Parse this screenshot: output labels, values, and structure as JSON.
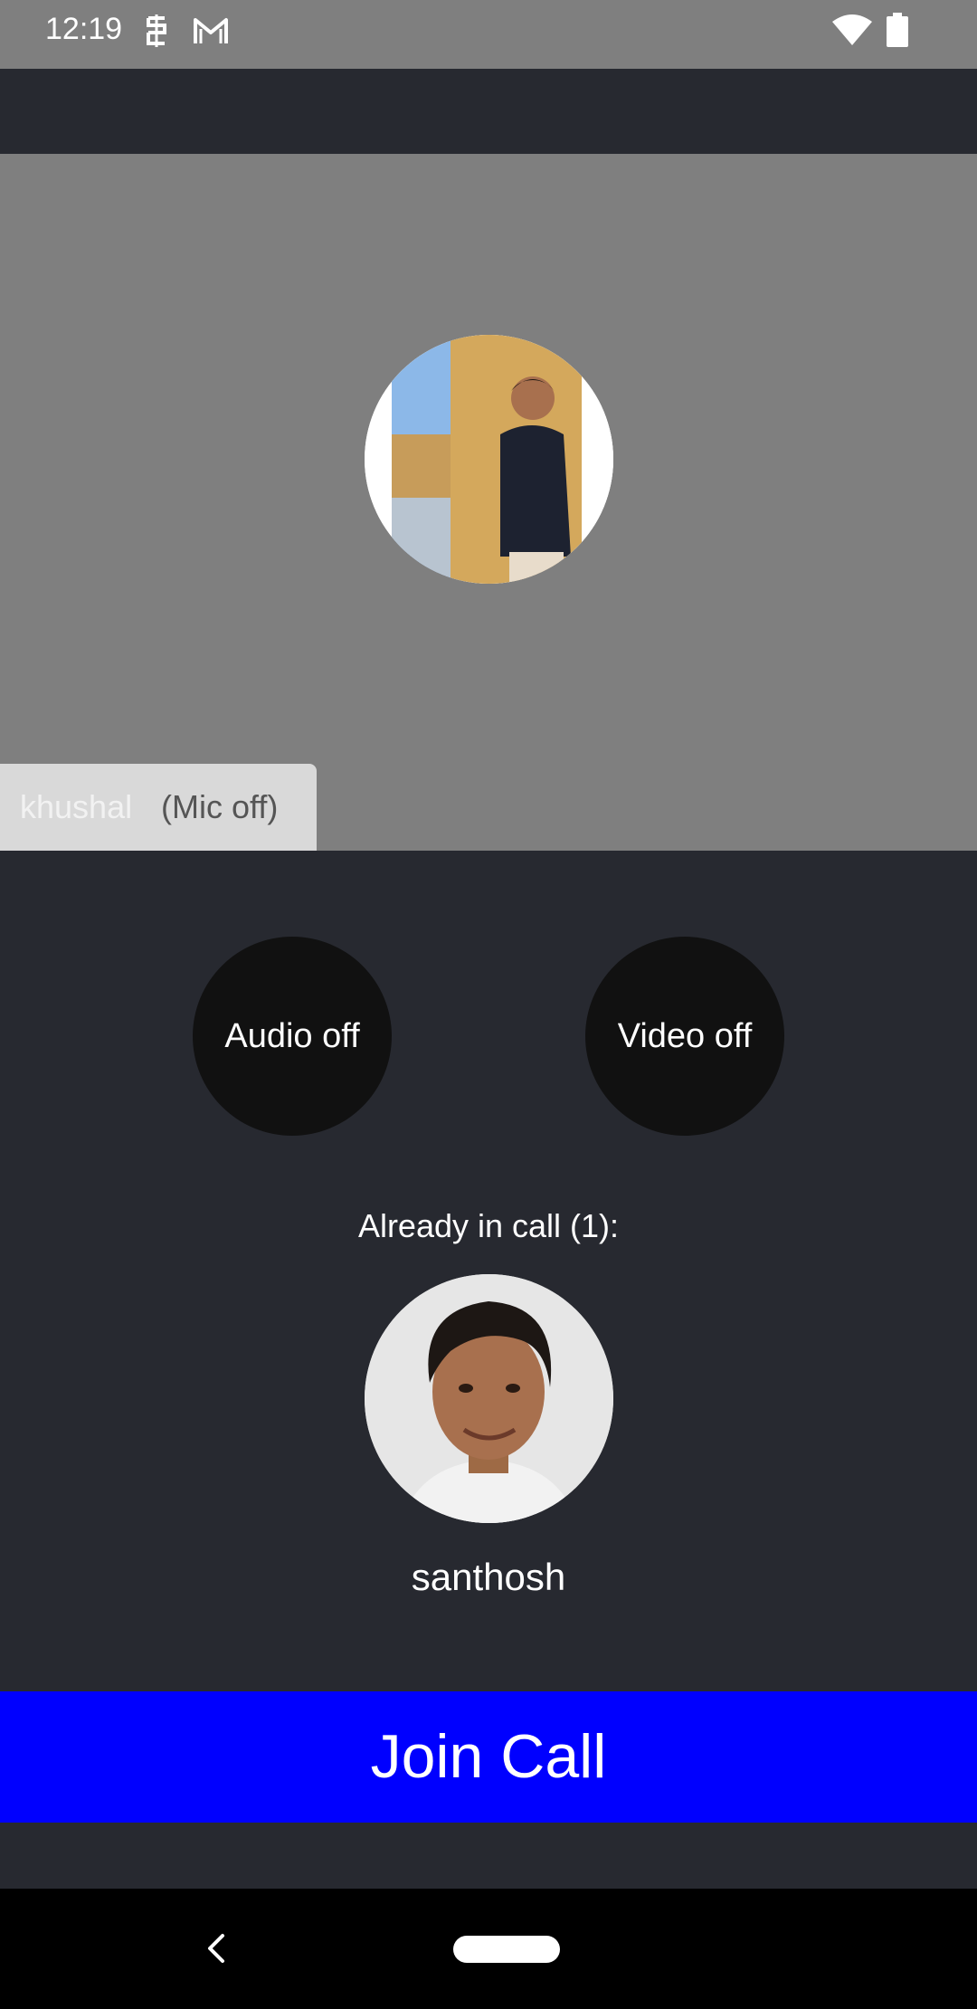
{
  "status_bar": {
    "time": "12:19",
    "icons": [
      "sim-icon",
      "gmail-icon",
      "wifi-icon",
      "battery-icon"
    ]
  },
  "preview": {
    "user_name": "khushal",
    "mic_status": "(Mic off)"
  },
  "controls": {
    "audio_label": "Audio off",
    "video_label": "Video off"
  },
  "participants": {
    "heading": "Already in call (1):",
    "list": [
      {
        "name": "santhosh"
      }
    ]
  },
  "join_button": {
    "label": "Join Call"
  },
  "colors": {
    "background": "#272930",
    "preview_bg": "#7f7f7f",
    "join_button": "#0000ff",
    "toggle_button": "#111111"
  }
}
